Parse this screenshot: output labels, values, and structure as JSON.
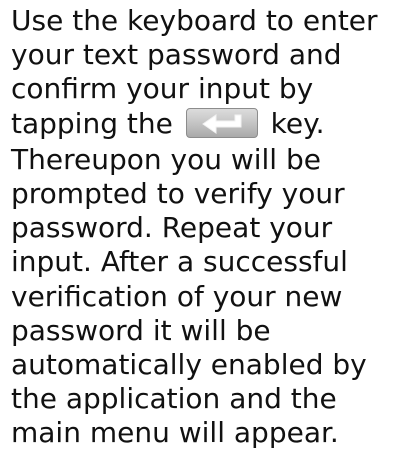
{
  "paragraphs": [
    {
      "before_icon_lines": [
        "Use the keyboard to enter",
        "your text password and",
        "confirm your input by"
      ],
      "icon_line_prefix": "tapping the",
      "icon": "enter-key-icon",
      "icon_line_suffix": "key."
    },
    {
      "lines": [
        "Thereupon you will be",
        "prompted to verify your",
        "password. Repeat your",
        "input. After a successful",
        "verification of your new",
        "password it will be",
        "automatically enabled by",
        "the application and the",
        "main menu will appear."
      ]
    }
  ],
  "colors": {
    "text": "#111111",
    "key_body": "#c7c7c7",
    "key_arrow": "#ffffff"
  }
}
